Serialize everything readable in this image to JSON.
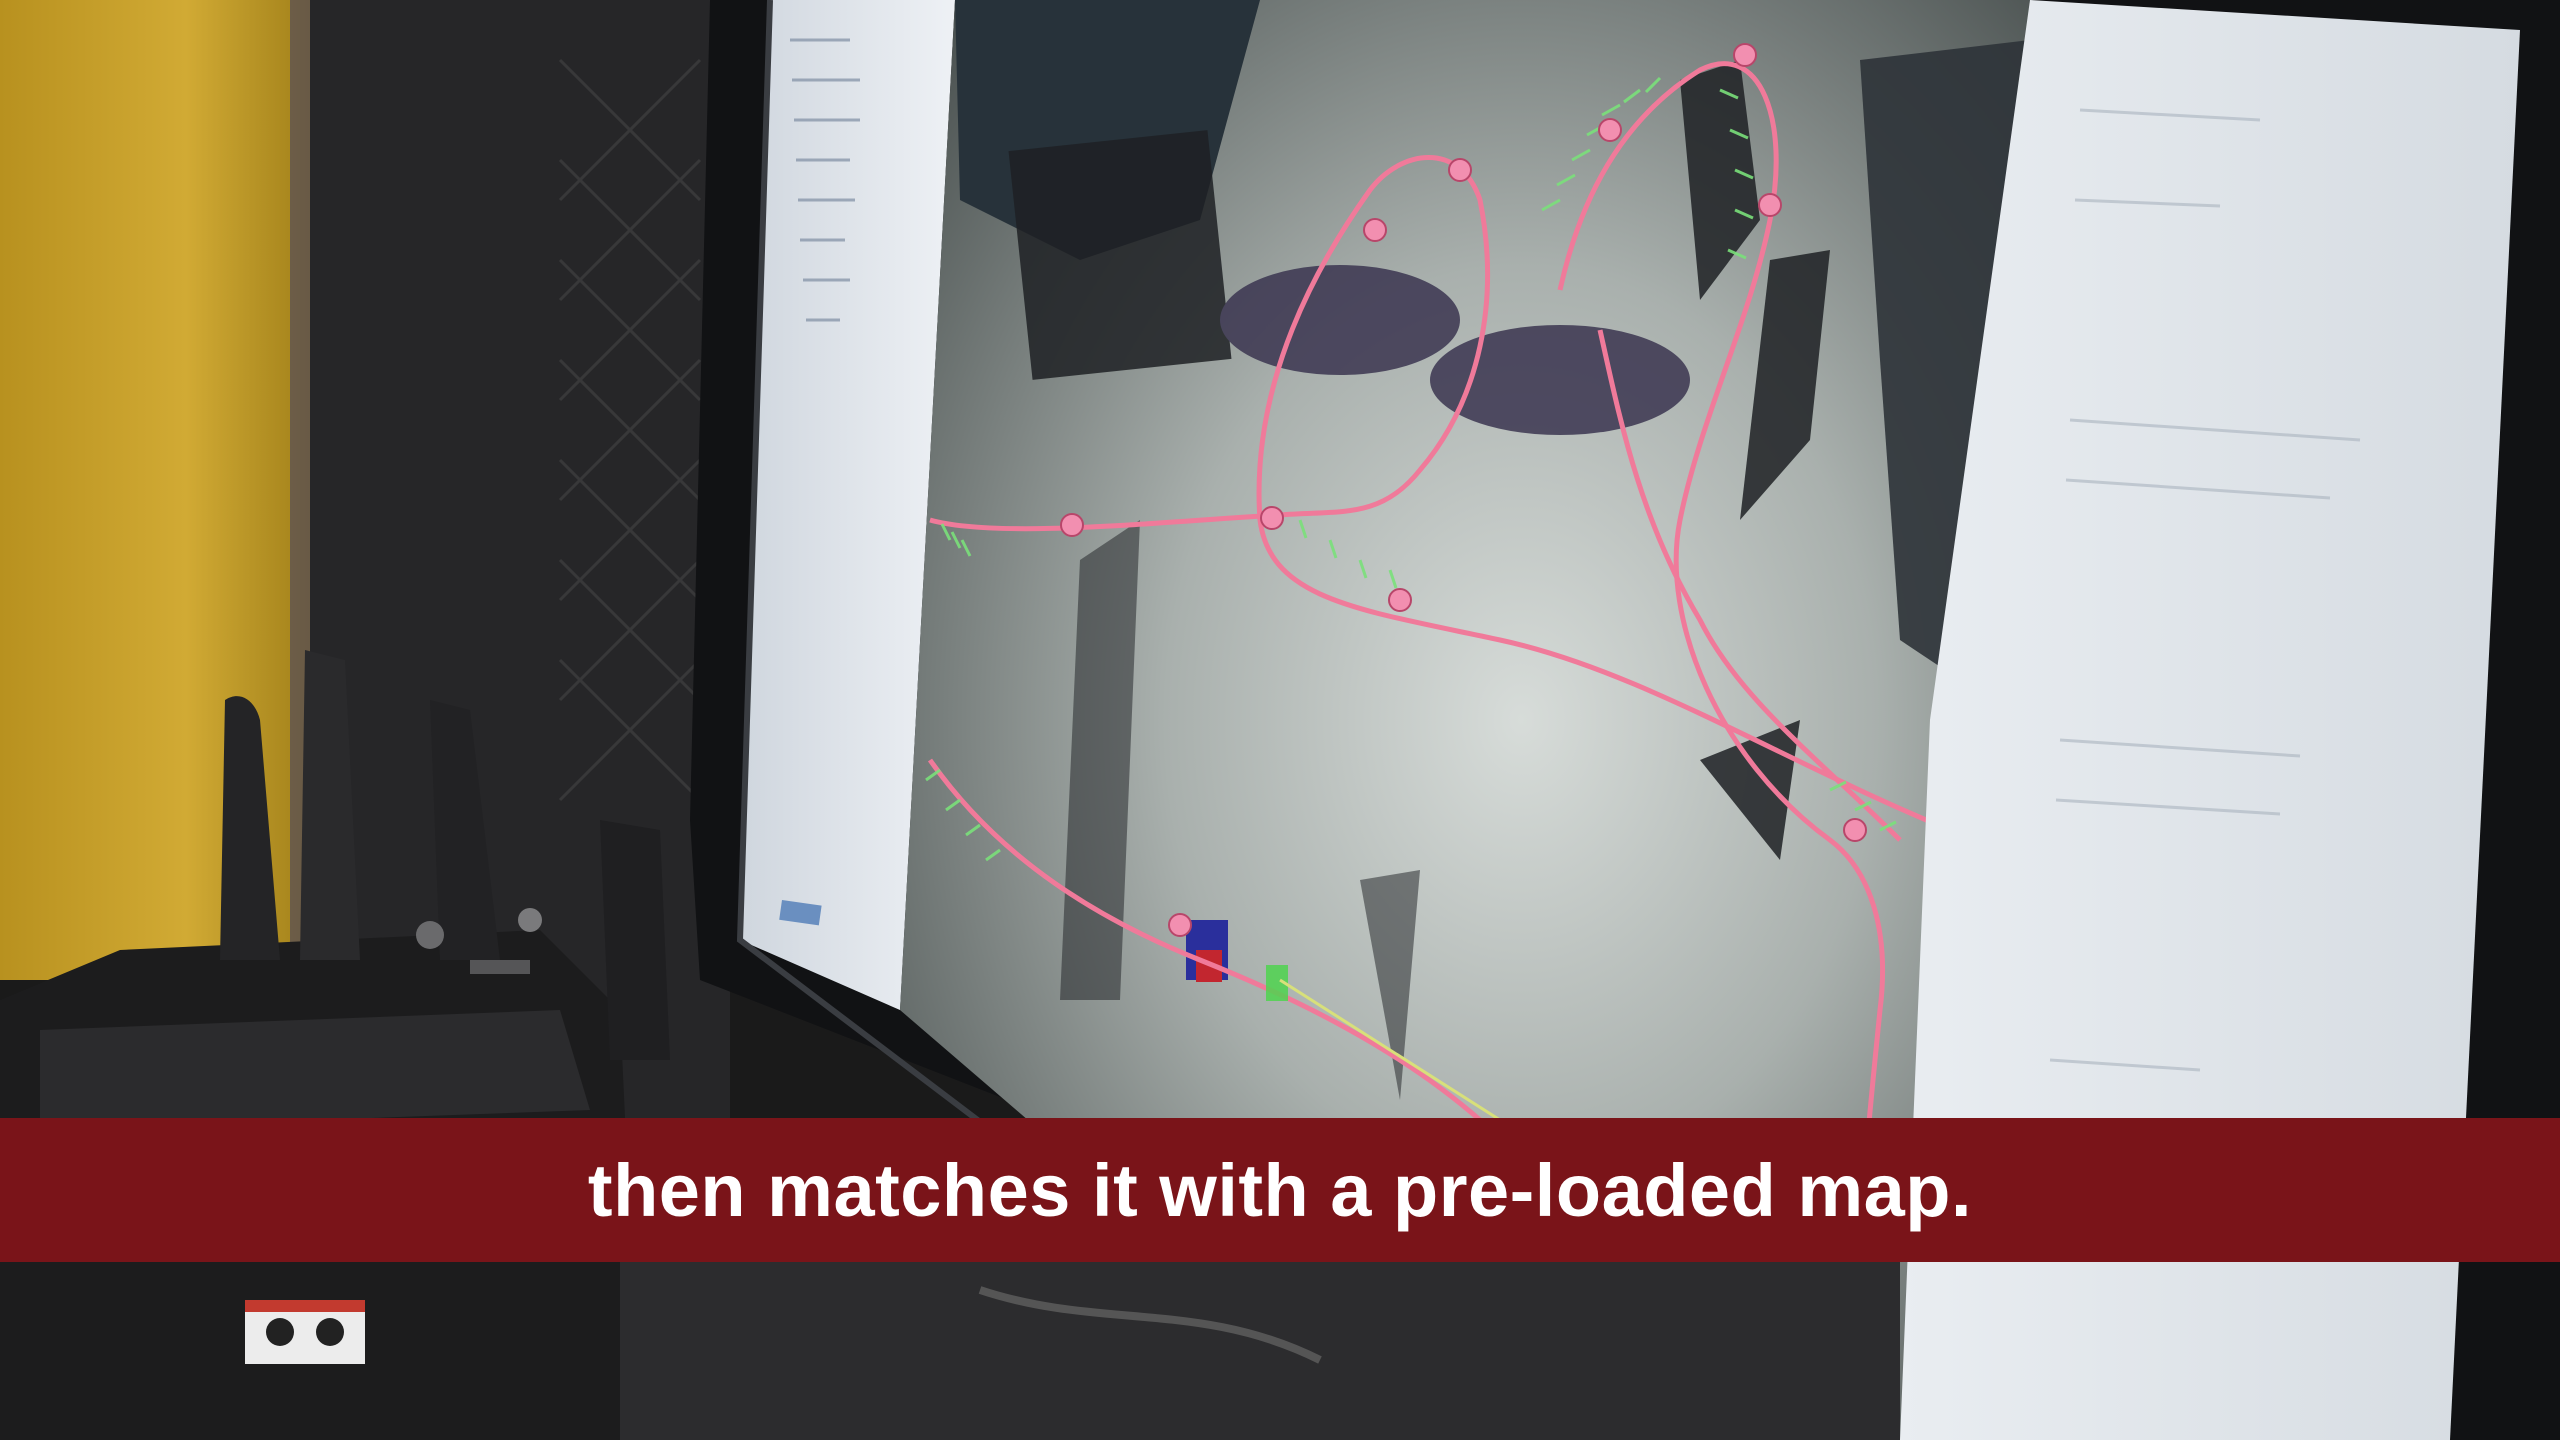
{
  "caption": {
    "text": "then matches it with a pre-loaded map."
  },
  "colors": {
    "caption_background": "#7a1419",
    "caption_text": "#ffffff",
    "wall_yellow": "#c9a12a",
    "flight_path": "#f07a9a",
    "waypoint_marker": "#f28fb0",
    "orientation_ticks": "#7be07b"
  },
  "scene": {
    "monitor": "computer monitor displaying 3D point-cloud map with planned flight path",
    "controller": "radio controller with antennas and sticks"
  }
}
